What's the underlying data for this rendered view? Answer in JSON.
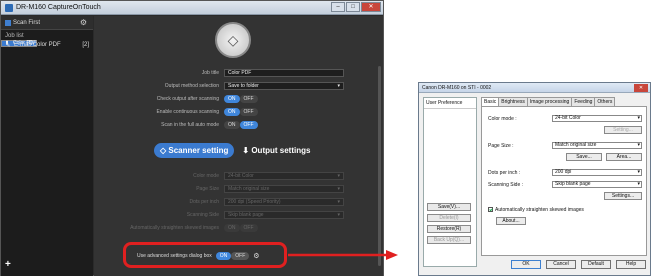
{
  "app": {
    "title": "DR-M160 CaptureOnTouch",
    "min_glyph": "–",
    "max_glyph": "□",
    "close_glyph": "✕"
  },
  "sidebar": {
    "scan_first": "Scan First",
    "gear_glyph": "⚙",
    "job_list_label": "Job list",
    "jobs": [
      {
        "label": "Color PDF",
        "count": "[1]",
        "icon": "▮"
      },
      {
        "label": "E-mail Color PDF",
        "count": "[2]",
        "icon": "✎"
      }
    ],
    "add_glyph": "+"
  },
  "main": {
    "start_glyph": "◇",
    "job_title_label": "Job title",
    "job_title_value": "Color PDF",
    "output_method_label": "Output method selection",
    "output_method_value": "Save to folder",
    "check_output_label": "Check output after scanning",
    "enable_cont_label": "Enable continuous scanning",
    "scan_full_auto_label": "Scan in the full auto mode",
    "on": "ON",
    "off": "OFF",
    "tab_scanner": "Scanner setting",
    "tab_output": "Output settings",
    "color_mode_label": "Color mode",
    "color_mode_value": "24-bit Color",
    "page_size_label": "Page Size",
    "page_size_value": "Match original size",
    "dots_label": "Dots per inch",
    "dots_value": "200 dpi (Speed Priority)",
    "scanning_side_label": "Scanning Side",
    "scanning_side_value": "Skip blank page",
    "straighten_label": "Automatically straighten skewed images",
    "advanced_label": "Use advanced settings dialog box",
    "dropdown_glyph": "▾"
  },
  "dialog": {
    "title": "Canon DR-M160 on STI - 0002",
    "close_glyph": "✕",
    "user_pref": "User Preference",
    "side_buttons": [
      "Save(V)...",
      "Delete(I)",
      "Restore(R)",
      "Back Up(Q)..."
    ],
    "tabs": [
      "Basic",
      "Brightness",
      "Image processing",
      "Feeding",
      "Others"
    ],
    "color_mode_label": "Color mode :",
    "color_mode_value": "24-bit Color",
    "setting_btn": "Setting...",
    "page_size_label": "Page Size :",
    "page_size_value": "Match original size",
    "save_btn": "Save...",
    "area_btn": "Area...",
    "dpi_label": "Dots per inch :",
    "dpi_value": "200 dpi",
    "side_label": "Scanning Side :",
    "side_value": "Skip blank page",
    "settings_btn": "Settings...",
    "straighten_label": "Automatically straighten skewed images",
    "about_btn": "About...",
    "footer": [
      "OK",
      "Cancel",
      "Default",
      "Help"
    ],
    "dropdown_glyph": "▾"
  }
}
